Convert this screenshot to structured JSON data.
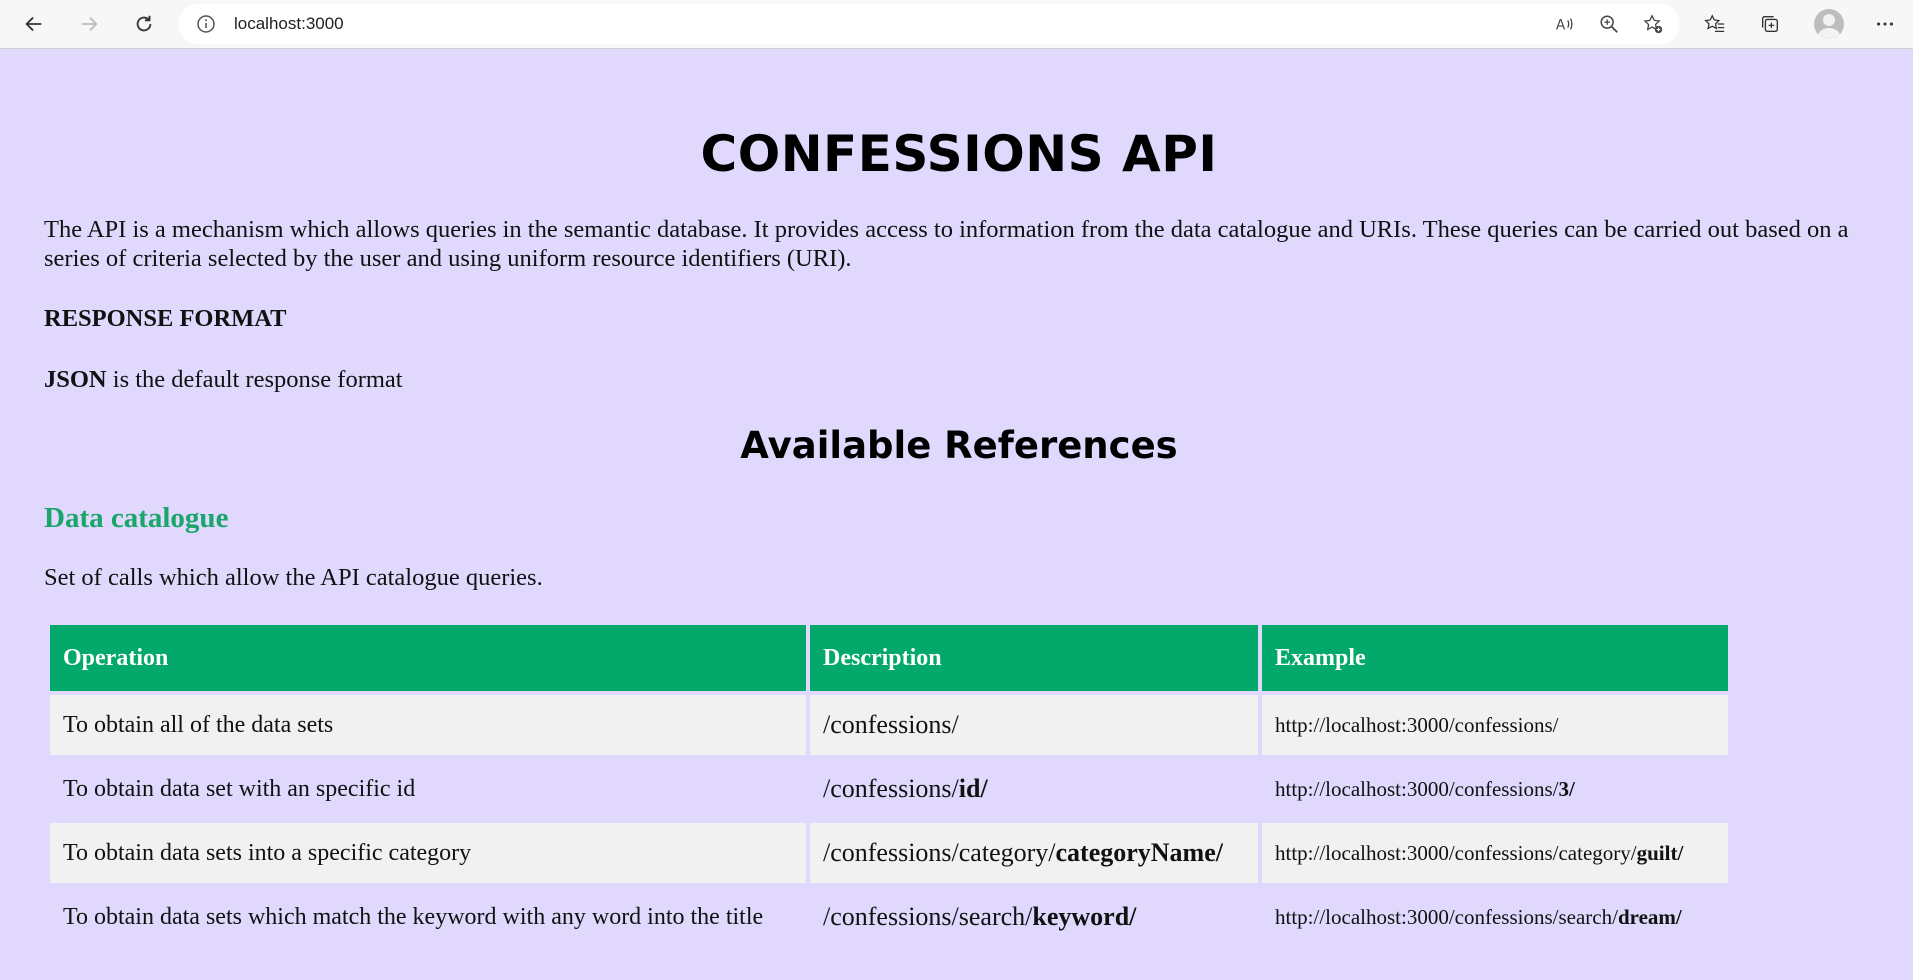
{
  "browser": {
    "url": "localhost:3000"
  },
  "page": {
    "title": "CONFESSIONS API",
    "intro": "The API is a mechanism which allows queries in the semantic database. It provides access to information from the data catalogue and URIs. These queries can be carried out based on a series of criteria selected by the user and using uniform resource identifiers (URI).",
    "response_format_heading": "RESPONSE FORMAT",
    "json_label": "JSON",
    "json_text": " is the default response format",
    "references_heading": "Available References",
    "catalogue_heading": "Data catalogue",
    "catalogue_desc": "Set of calls which allow the API catalogue queries."
  },
  "table": {
    "headers": {
      "operation": "Operation",
      "description": "Description",
      "example": "Example"
    },
    "rows": [
      {
        "operation": "To obtain all of the data sets",
        "desc_plain": "/confessions/",
        "desc_bold": "",
        "ex_plain": "http://localhost:3000/confessions/",
        "ex_bold": ""
      },
      {
        "operation": "To obtain data set with an specific id",
        "desc_plain": "/confessions/",
        "desc_bold": "id/",
        "ex_plain": "http://localhost:3000/confessions/",
        "ex_bold": "3/"
      },
      {
        "operation": "To obtain data sets into a specific category",
        "desc_plain": "/confessions/category/",
        "desc_bold": "categoryName/",
        "ex_plain": "http://localhost:3000/confessions/category/",
        "ex_bold": "guilt/"
      },
      {
        "operation": "To obtain data sets which match the keyword with any word into the title",
        "desc_plain": "/confessions/search/",
        "desc_bold": "keyword/",
        "ex_plain": "http://localhost:3000/confessions/search/",
        "ex_bold": "dream/"
      }
    ]
  },
  "colors": {
    "page_background": "#e0d8fd",
    "accent_green": "#03a96b",
    "heading_green": "#1aa56a",
    "row_light": "#f1f1f1"
  },
  "icons": {
    "toolbar": [
      "back-arrow-icon",
      "forward-arrow-icon",
      "refresh-icon",
      "info-icon",
      "read-aloud-icon",
      "zoom-icon",
      "add-favorite-icon",
      "favorites-icon",
      "collections-icon",
      "profile-avatar-icon",
      "more-menu-icon"
    ]
  }
}
